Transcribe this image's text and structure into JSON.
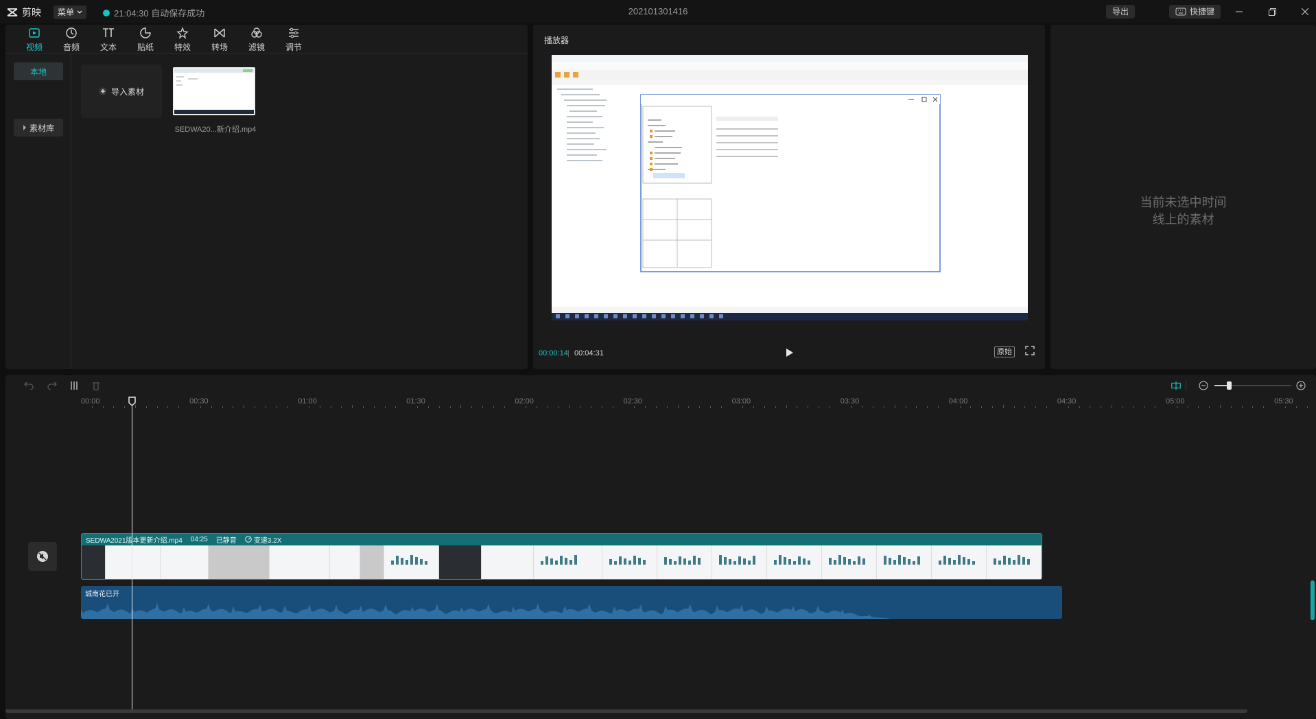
{
  "titlebar": {
    "app_name": "剪映",
    "menu_label": "菜单",
    "save_status": "21:04:30 自动保存成功",
    "project_title": "202101301416",
    "export_label": "导出",
    "shortcut_label": "快捷键"
  },
  "media_tabs": [
    {
      "label": "视频",
      "icon": "video-icon",
      "active": true
    },
    {
      "label": "音频",
      "icon": "audio-icon"
    },
    {
      "label": "文本",
      "icon": "text-icon"
    },
    {
      "label": "贴纸",
      "icon": "sticker-icon"
    },
    {
      "label": "特效",
      "icon": "effects-icon"
    },
    {
      "label": "转场",
      "icon": "transition-icon"
    },
    {
      "label": "滤镜",
      "icon": "filter-icon"
    },
    {
      "label": "调节",
      "icon": "adjust-icon"
    }
  ],
  "media_sidebar": {
    "local": "本地",
    "library": "素材库"
  },
  "media": {
    "import_label": "导入素材",
    "item_name": "SEDWA20...新介绍.mp4"
  },
  "player": {
    "title": "播放器",
    "time_current": "00:00:14",
    "time_sep": "|",
    "time_total": "00:04:31",
    "original_label": "原始"
  },
  "details": {
    "empty_line1": "当前未选中时间",
    "empty_line2": "线上的素材"
  },
  "timeline": {
    "ruler_labels": [
      "00:00",
      "00:30",
      "01:00",
      "01:30",
      "02:00",
      "02:30",
      "03:00",
      "03:30",
      "04:00",
      "04:30",
      "05:00",
      "05:30"
    ],
    "video_clip": {
      "name": "SEDWA2021版本更新介绍.mp4",
      "duration": "04:25",
      "muted": "已静音",
      "speed": "变速3.2X"
    },
    "audio_clip": {
      "name": "城南花已开"
    }
  },
  "colors": {
    "accent": "#19c4c4",
    "video_clip": "#0f6e73",
    "audio_clip": "#1a4e7a"
  }
}
